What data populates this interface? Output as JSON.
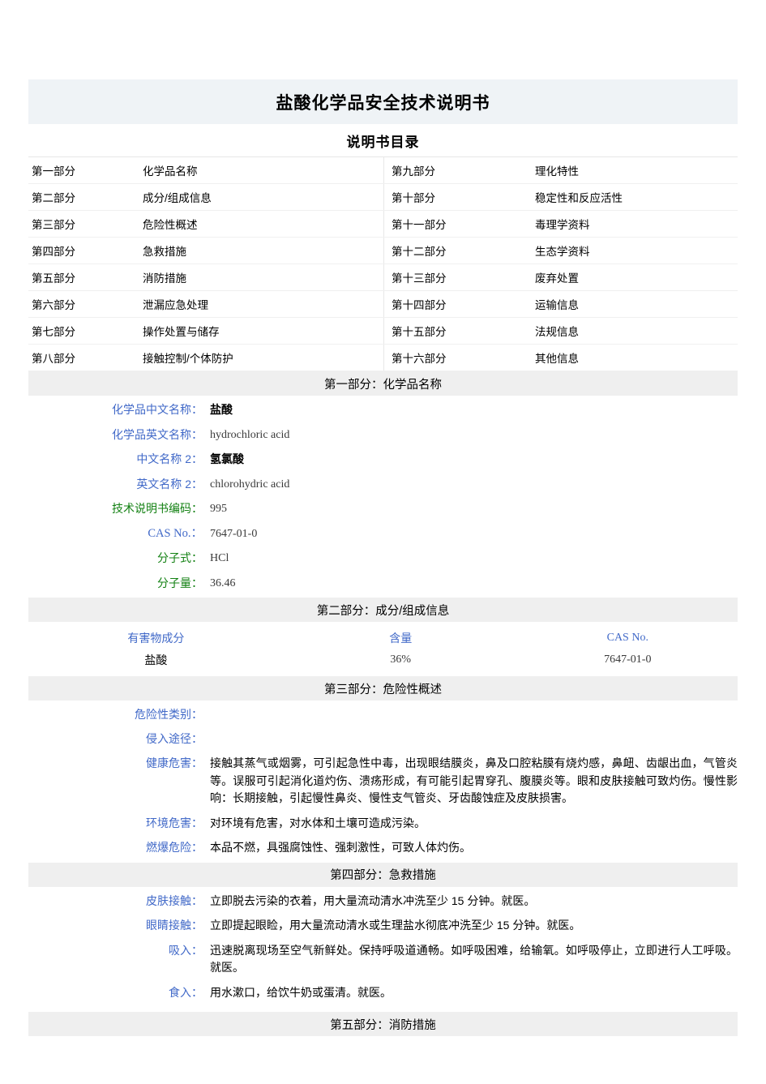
{
  "document": {
    "title": "盐酸化学品安全技术说明书",
    "toc_title": "说明书目录"
  },
  "toc": {
    "rows": [
      {
        "left_no": "第一部分",
        "left_name": "化学品名称",
        "right_no": "第九部分",
        "right_name": "理化特性"
      },
      {
        "left_no": "第二部分",
        "left_name": "成分/组成信息",
        "right_no": "第十部分",
        "right_name": "稳定性和反应活性"
      },
      {
        "left_no": "第三部分",
        "left_name": "危险性概述",
        "right_no": "第十一部分",
        "right_name": "毒理学资料"
      },
      {
        "left_no": "第四部分",
        "left_name": "急救措施",
        "right_no": "第十二部分",
        "right_name": "生态学资料"
      },
      {
        "left_no": "第五部分",
        "left_name": "消防措施",
        "right_no": "第十三部分",
        "right_name": "废弃处置"
      },
      {
        "left_no": "第六部分",
        "left_name": "泄漏应急处理",
        "right_no": "第十四部分",
        "right_name": "运输信息"
      },
      {
        "left_no": "第七部分",
        "left_name": "操作处置与储存",
        "right_no": "第十五部分",
        "right_name": "法规信息"
      },
      {
        "left_no": "第八部分",
        "left_name": "接触控制/个体防护",
        "right_no": "第十六部分",
        "right_name": "其他信息"
      }
    ]
  },
  "section1": {
    "header": "第一部分：化学品名称",
    "fields": [
      {
        "label": "化学品中文名称：",
        "value": "盐酸"
      },
      {
        "label": "化学品英文名称：",
        "value": "hydrochloric acid"
      },
      {
        "label": "中文名称 2：",
        "value": "氢氯酸"
      },
      {
        "label": "英文名称 2：",
        "value": "chlorohydric acid"
      },
      {
        "label": "技术说明书编码：",
        "value": "995"
      },
      {
        "label": "CAS No.：",
        "value": "7647-01-0"
      },
      {
        "label": "分子式：",
        "value": "HCl"
      },
      {
        "label": "分子量：",
        "value": "36.46"
      }
    ]
  },
  "section2": {
    "header": "第二部分：成分/组成信息",
    "columns": [
      "有害物成分",
      "含量",
      "CAS No."
    ],
    "rows": [
      {
        "component": "盐酸",
        "content": "36%",
        "cas": "7647-01-0"
      }
    ]
  },
  "section3": {
    "header": "第三部分：危险性概述",
    "fields": [
      {
        "label": "危险性类别：",
        "value": ""
      },
      {
        "label": "侵入途径：",
        "value": ""
      },
      {
        "label": "健康危害：",
        "value": "接触其蒸气或烟雾，可引起急性中毒，出现眼结膜炎，鼻及口腔粘膜有烧灼感，鼻衄、齿龈出血，气管炎等。误服可引起消化道灼伤、溃疡形成，有可能引起胃穿孔、腹膜炎等。眼和皮肤接触可致灼伤。慢性影响：长期接触，引起慢性鼻炎、慢性支气管炎、牙齿酸蚀症及皮肤损害。"
      },
      {
        "label": "环境危害：",
        "value": "对环境有危害，对水体和土壤可造成污染。"
      },
      {
        "label": "燃爆危险：",
        "value": "本品不燃，具强腐蚀性、强刺激性，可致人体灼伤。"
      }
    ]
  },
  "section4": {
    "header": "第四部分：急救措施",
    "fields": [
      {
        "label": "皮肤接触：",
        "value": "立即脱去污染的衣着，用大量流动清水冲洗至少 15 分钟。就医。"
      },
      {
        "label": "眼睛接触：",
        "value": "立即提起眼睑，用大量流动清水或生理盐水彻底冲洗至少 15 分钟。就医。"
      },
      {
        "label": "吸入：",
        "value": "迅速脱离现场至空气新鲜处。保持呼吸道通畅。如呼吸困难，给输氧。如呼吸停止，立即进行人工呼吸。就医。"
      },
      {
        "label": "食入：",
        "value": "用水漱口，给饮牛奶或蛋清。就医。"
      }
    ]
  },
  "section5": {
    "header": "第五部分：消防措施"
  }
}
